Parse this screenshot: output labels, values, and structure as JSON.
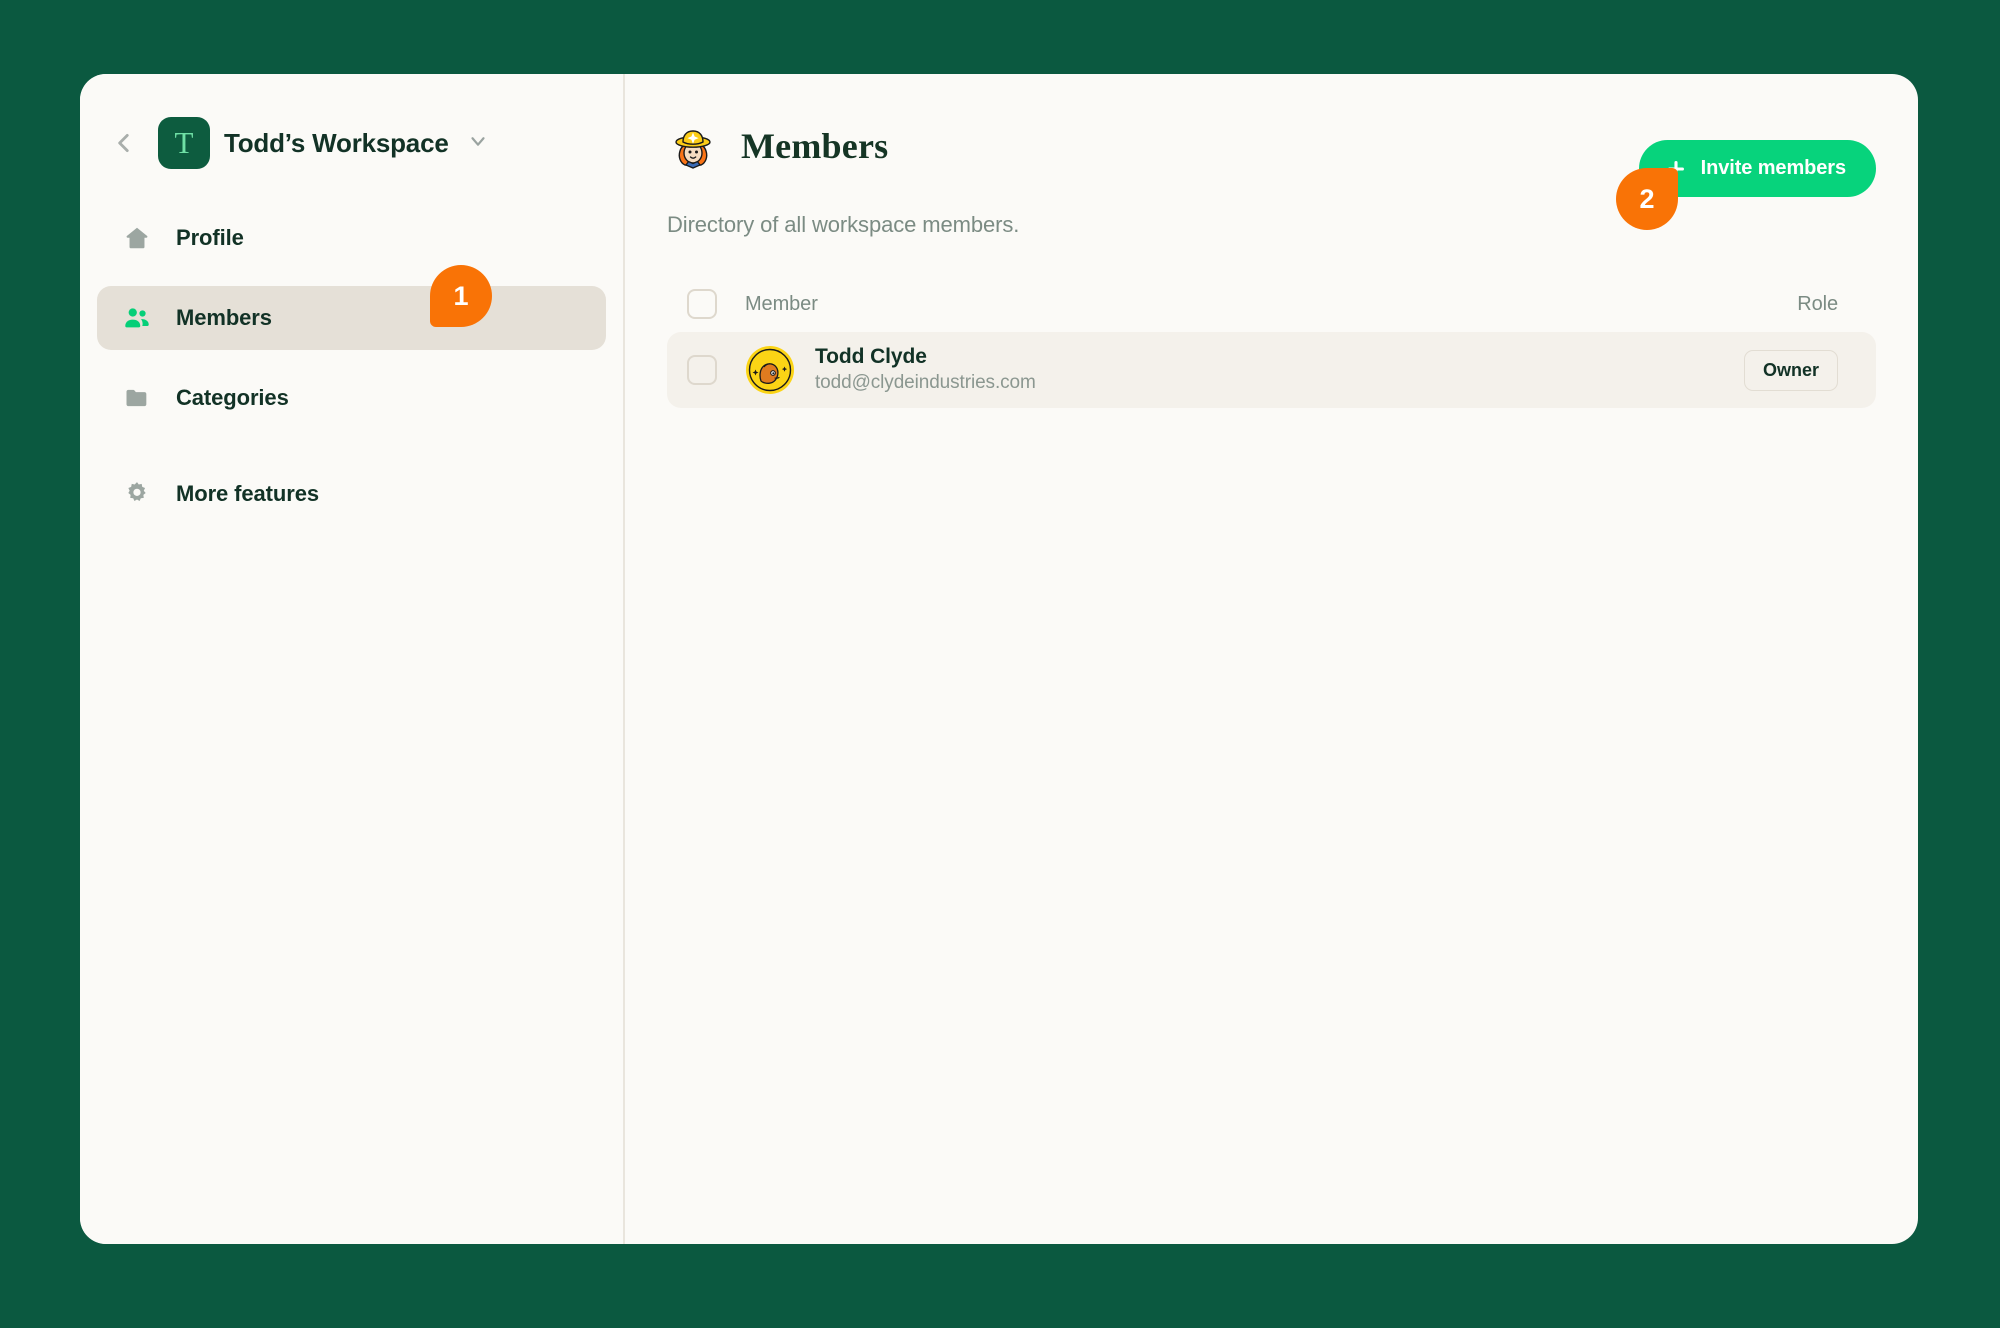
{
  "theme": {
    "page_background": "#0b5940",
    "panel_background": "#fbfaf7",
    "accent_green": "#07d37c",
    "brand_dark_green": "#0d5c3f",
    "callout_orange": "#f97306",
    "active_nav_background": "#e5e0d7",
    "row_background": "#f4f1eb",
    "muted_text": "#7b8b83",
    "heading_text": "#123226"
  },
  "sidebar": {
    "back_icon": "chevron-left-icon",
    "workspace": {
      "logo_letter": "T",
      "name": "Todd’s Workspace",
      "chevron_icon": "chevron-down-icon"
    },
    "items": [
      {
        "label": "Profile",
        "icon": "home-icon",
        "active": false
      },
      {
        "label": "Members",
        "icon": "people-icon",
        "active": true
      },
      {
        "label": "Categories",
        "icon": "folder-icon",
        "active": false
      },
      {
        "label": "More features",
        "icon": "gear-icon",
        "active": false
      }
    ]
  },
  "main": {
    "header": {
      "avatar_icon": "cowgirl-avatar-icon",
      "title": "Members",
      "invite_button": {
        "label": "Invite members",
        "icon": "plus-icon"
      }
    },
    "subtitle": "Directory of all workspace members.",
    "table": {
      "columns": {
        "select": "select-all-checkbox",
        "member": "Member",
        "role": "Role"
      },
      "rows": [
        {
          "avatar_icon": "user-avatar-icon",
          "name": "Todd Clyde",
          "email": "todd@clydeindustries.com",
          "role": "Owner",
          "selected": false
        }
      ]
    }
  },
  "callouts": [
    {
      "number": "1"
    },
    {
      "number": "2"
    }
  ]
}
